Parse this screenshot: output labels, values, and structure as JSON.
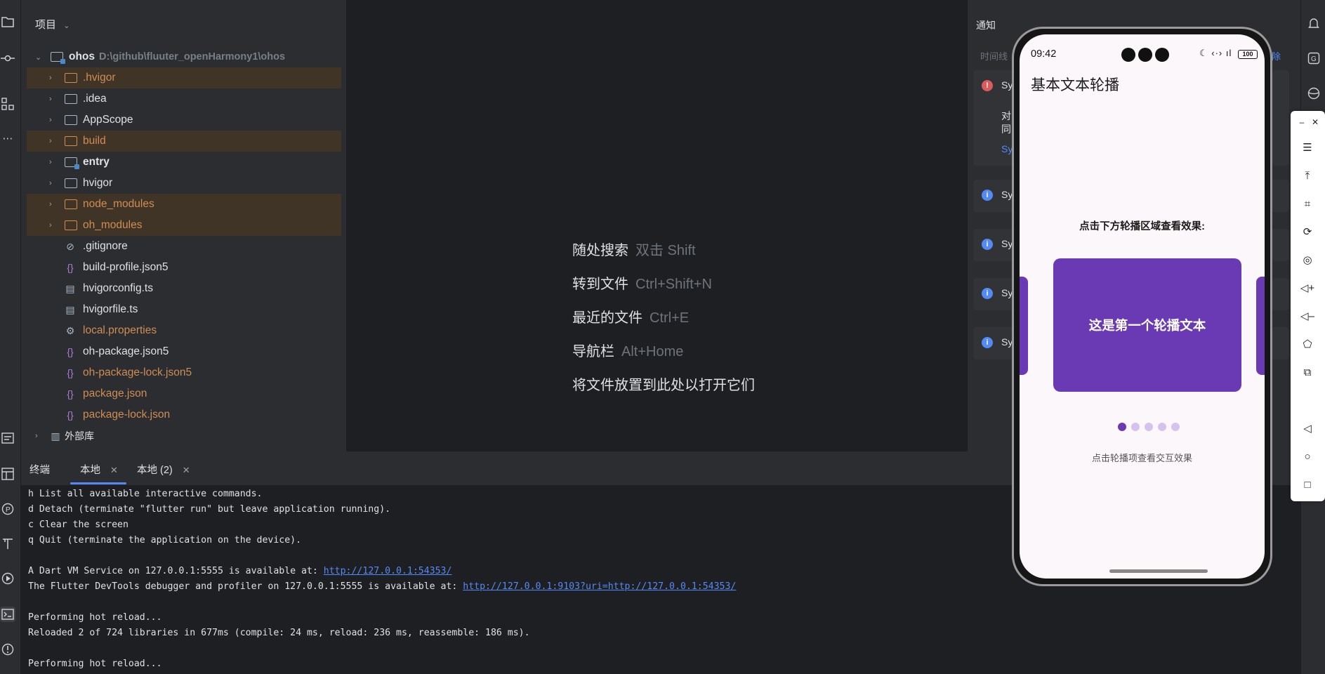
{
  "project": {
    "title": "项目",
    "root_name": "ohos",
    "root_path": "D:\\github\\fluuter_openHarmony1\\ohos",
    "items": [
      {
        "label": ".hvigor",
        "type": "folder",
        "excluded": true
      },
      {
        "label": ".idea",
        "type": "folder",
        "excluded": false
      },
      {
        "label": "AppScope",
        "type": "folder",
        "excluded": false
      },
      {
        "label": "build",
        "type": "folder",
        "excluded": true
      },
      {
        "label": "entry",
        "type": "module",
        "excluded": false
      },
      {
        "label": "hvigor",
        "type": "folder",
        "excluded": false
      },
      {
        "label": "node_modules",
        "type": "folder",
        "excluded": true
      },
      {
        "label": "oh_modules",
        "type": "folder",
        "excluded": true
      },
      {
        "label": ".gitignore",
        "type": "file-ignore"
      },
      {
        "label": "build-profile.json5",
        "type": "file-json"
      },
      {
        "label": "hvigorconfig.ts",
        "type": "file-ts"
      },
      {
        "label": "hvigorfile.ts",
        "type": "file-ts"
      },
      {
        "label": "local.properties",
        "type": "file-gear"
      },
      {
        "label": "oh-package.json5",
        "type": "file-json"
      },
      {
        "label": "oh-package-lock.json5",
        "type": "file-json"
      },
      {
        "label": "package.json",
        "type": "file-json"
      },
      {
        "label": "package-lock.json",
        "type": "file-json"
      }
    ],
    "external": "外部库"
  },
  "editor": {
    "hints": [
      {
        "label": "随处搜索",
        "key": "双击 Shift"
      },
      {
        "label": "转到文件",
        "key": "Ctrl+Shift+N"
      },
      {
        "label": "最近的文件",
        "key": "Ctrl+E"
      },
      {
        "label": "导航栏",
        "key": "Alt+Home"
      },
      {
        "label": "将文件放置到此处以打开它们",
        "key": ""
      }
    ]
  },
  "notifications": {
    "title": "通知",
    "subtitle": "时间线",
    "clear": "除",
    "cards": [
      {
        "kind": "error",
        "title": "Sy",
        "line1": "对",
        "line2": "同",
        "link": "Sy"
      },
      {
        "kind": "info",
        "title": "Sy"
      },
      {
        "kind": "info",
        "title": "Sy"
      },
      {
        "kind": "info",
        "title": "Sy"
      },
      {
        "kind": "info",
        "title": "Sy"
      }
    ]
  },
  "terminal": {
    "tabs": [
      {
        "label": "终端"
      },
      {
        "label": "本地"
      },
      {
        "label": "本地 (2)"
      }
    ],
    "lines": [
      {
        "text": "h List all available interactive commands."
      },
      {
        "text": "d Detach (terminate \"flutter run\" but leave application running)."
      },
      {
        "text": "c Clear the screen"
      },
      {
        "text": "q Quit (terminate the application on the device)."
      },
      {
        "text": ""
      },
      {
        "text": "A Dart VM Service on 127.0.0.1:5555 is available at: ",
        "link": "http://127.0.0.1:54353/"
      },
      {
        "text": "The Flutter DevTools debugger and profiler on 127.0.0.1:5555 is available at: ",
        "link": "http://127.0.0.1:9103?uri=http://127.0.0.1:54353/"
      },
      {
        "text": ""
      },
      {
        "text": "Performing hot reload..."
      },
      {
        "text": "Reloaded 2 of 724 libraries in 677ms (compile: 24 ms, reload: 236 ms, reassemble: 186 ms)."
      },
      {
        "text": ""
      },
      {
        "text": "Performing hot reload..."
      }
    ]
  },
  "phone": {
    "time": "09:42",
    "battery": "100",
    "app_title": "基本文本轮播",
    "prompt": "点击下方轮播区域查看效果:",
    "slide_text": "这是第一个轮播文本",
    "dot_count": 5,
    "active_dot": 0,
    "footer_hint": "点击轮播项查看交互效果"
  },
  "colors": {
    "accent": "#548af7",
    "carousel": "#6a3ab5",
    "excluded_bg": "#3f3426",
    "excluded_text": "#d08d54"
  }
}
